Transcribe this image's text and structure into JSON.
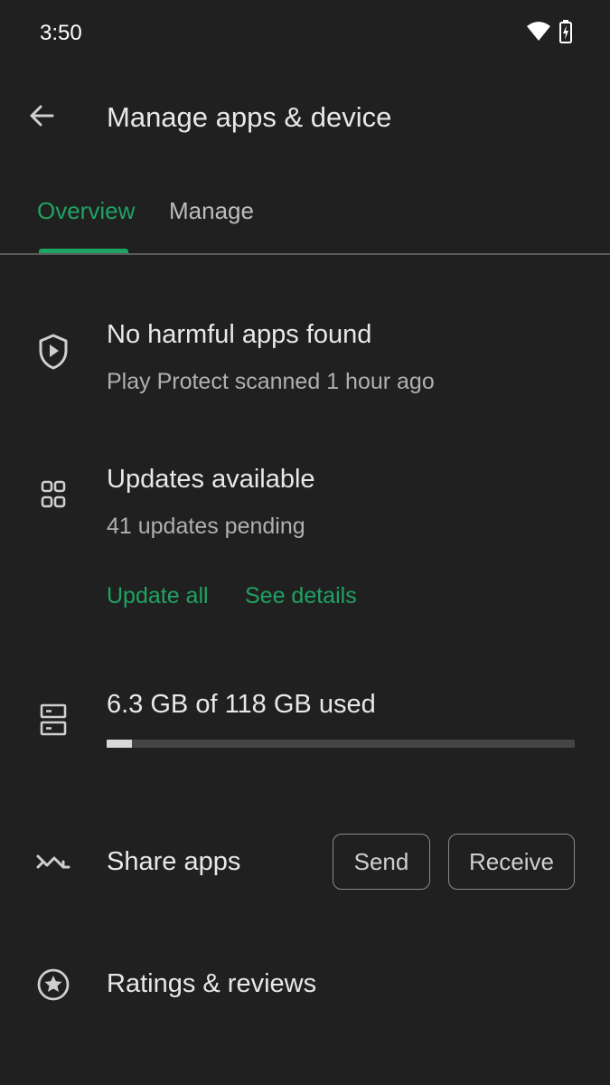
{
  "status_bar": {
    "time": "3:50",
    "icons": [
      "wifi-icon",
      "battery-charging-icon"
    ]
  },
  "app_bar": {
    "back_icon": "arrow-back-icon",
    "title": "Manage apps & device"
  },
  "tabs": [
    {
      "label": "Overview",
      "selected": true
    },
    {
      "label": "Manage",
      "selected": false
    }
  ],
  "protect": {
    "icon": "shield-play-icon",
    "title": "No harmful apps found",
    "subtitle": "Play Protect scanned 1 hour ago"
  },
  "updates": {
    "icon": "apps-grid-icon",
    "title": "Updates available",
    "subtitle": "41 updates pending",
    "update_all_label": "Update all",
    "see_details_label": "See details"
  },
  "storage": {
    "icon": "storage-icon",
    "title": "6.3 GB of 118 GB used",
    "used_fraction": 0.0534
  },
  "share": {
    "icon": "share-apps-icon",
    "title": "Share apps",
    "send_label": "Send",
    "receive_label": "Receive"
  },
  "ratings": {
    "icon": "star-circle-icon",
    "title": "Ratings & reviews"
  },
  "colors": {
    "background": "#202020",
    "accent": "#1ea362",
    "text_primary": "#e8e8e8",
    "text_secondary": "#b0b0b0"
  }
}
